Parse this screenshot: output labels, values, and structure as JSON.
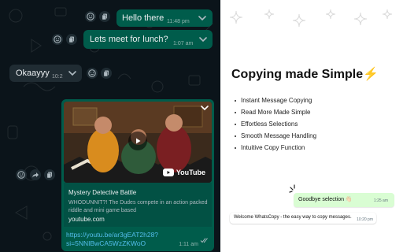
{
  "chat": {
    "messages": [
      {
        "text": "Hello there",
        "time": "11:48 pm"
      },
      {
        "text": "Lets meet for lunch?",
        "time": "1:07 am"
      },
      {
        "text": "Okaayyy",
        "time": "10:2"
      }
    ],
    "link_preview": {
      "title": "Mystery Detective Battle",
      "description": "WHODUNNIT?! The Dudes compete in an action packed riddle and mini game based",
      "domain": "youtube.com",
      "url_line1": "https://youtu.be/ar3gEAT2h28?",
      "url_line2": "si=5NNIBwCA5WzZKWoO",
      "time": "1:11 am",
      "brand": "YouTube"
    }
  },
  "promo": {
    "title": "Copying made Simple",
    "title_emoji": "⚡",
    "features": [
      "Instant Message Copying",
      "Read More Made Simple",
      "Effortless Selections",
      "Smooth Message Handling",
      "Intuitive Copy Function"
    ],
    "demo_out": {
      "text": "Goodbye selection 👋🏻",
      "time": "1:25 am"
    },
    "demo_in": {
      "text": "Welcome WhatsCopy - the easy way to copy messages.",
      "time": "10:20 pm"
    }
  },
  "colors": {
    "chat_bg": "#0b141a",
    "outgoing_bubble": "#005c4b",
    "incoming_bubble": "#202c33",
    "link": "#53bdeb",
    "accent": "#25d366"
  },
  "icons": [
    "smiley-icon",
    "copy-icon",
    "forward-icon",
    "chevron-down-icon",
    "play-icon",
    "double-check-icon",
    "sparkle-icon"
  ]
}
